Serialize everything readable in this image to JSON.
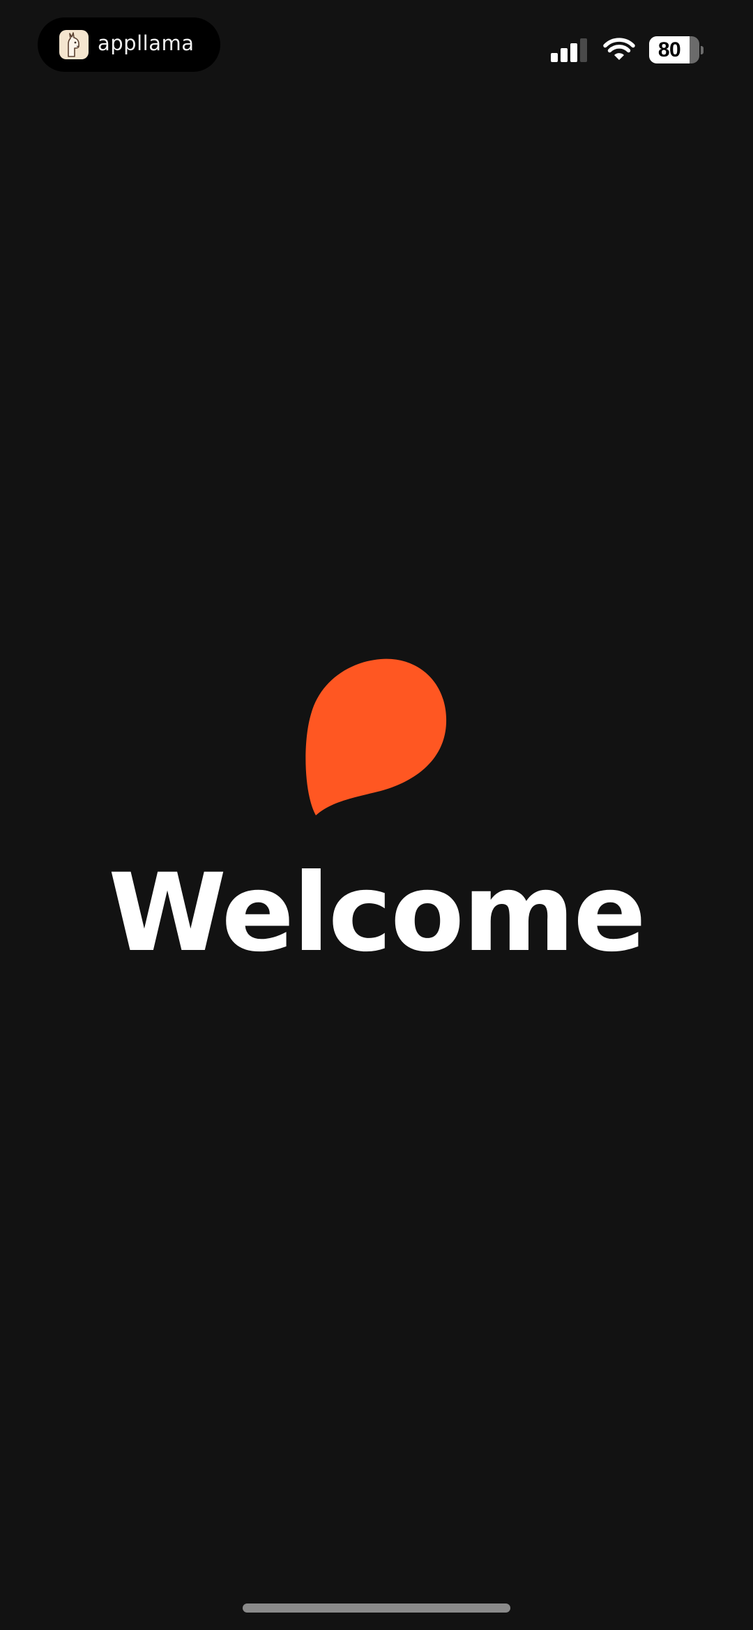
{
  "status_bar": {
    "app_name": "appllama",
    "app_icon": "llama-icon",
    "signal_icon": "cellular-signal-icon",
    "signal_bars_active": 3,
    "signal_bars_total": 4,
    "wifi_icon": "wifi-icon",
    "battery_icon": "battery-icon",
    "battery_level": "80",
    "battery_fraction": 0.8
  },
  "main": {
    "logo_icon": "orange-drop-logo-icon",
    "welcome_text": "Welcome"
  },
  "colors": {
    "background": "#121212",
    "accent": "#FF5722",
    "text": "#FFFFFF"
  }
}
